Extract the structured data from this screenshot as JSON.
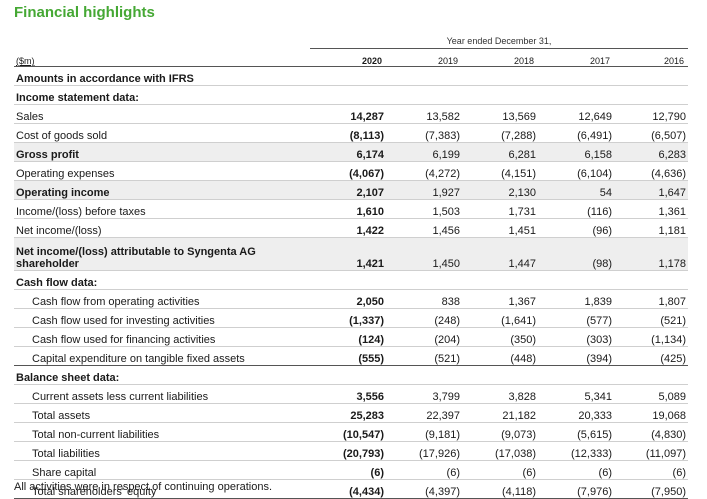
{
  "title": "Financial highlights",
  "period_label": "Year ended December 31,",
  "unit_label": "($m)",
  "years": [
    "2020",
    "2019",
    "2018",
    "2017",
    "2016"
  ],
  "rows": [
    {
      "label": "Amounts in accordance with IFRS",
      "type": "section",
      "values": []
    },
    {
      "label": "Income statement data:",
      "type": "section",
      "values": []
    },
    {
      "label": "Sales",
      "type": "row",
      "values": [
        "14,287",
        "13,582",
        "13,569",
        "12,649",
        "12,790"
      ]
    },
    {
      "label": "Cost of goods sold",
      "type": "row",
      "values": [
        "(8,113)",
        "(7,383)",
        "(7,288)",
        "(6,491)",
        "(6,507)"
      ]
    },
    {
      "label": "Gross profit",
      "type": "row",
      "bold": true,
      "shaded": true,
      "values": [
        "6,174",
        "6,199",
        "6,281",
        "6,158",
        "6,283"
      ]
    },
    {
      "label": "Operating expenses",
      "type": "row",
      "values": [
        "(4,067)",
        "(4,272)",
        "(4,151)",
        "(6,104)",
        "(4,636)"
      ]
    },
    {
      "label": "Operating income",
      "type": "row",
      "bold": true,
      "shaded": true,
      "values": [
        "2,107",
        "1,927",
        "2,130",
        "54",
        "1,647"
      ]
    },
    {
      "label": "Income/(loss) before taxes",
      "type": "row",
      "values": [
        "1,610",
        "1,503",
        "1,731",
        "(116)",
        "1,361"
      ]
    },
    {
      "label": "Net income/(loss)",
      "type": "row",
      "values": [
        "1,422",
        "1,456",
        "1,451",
        "(96)",
        "1,181"
      ]
    },
    {
      "label": "Net income/(loss) attributable to Syngenta AG shareholder",
      "type": "row",
      "bold": true,
      "shaded": true,
      "tall": true,
      "values": [
        "1,421",
        "1,450",
        "1,447",
        "(98)",
        "1,178"
      ]
    },
    {
      "label": "Cash flow data:",
      "type": "section",
      "values": []
    },
    {
      "label": "Cash flow from operating activities",
      "type": "row",
      "indent": true,
      "values": [
        "2,050",
        "838",
        "1,367",
        "1,839",
        "1,807"
      ]
    },
    {
      "label": "Cash flow used for investing activities",
      "type": "row",
      "indent": true,
      "values": [
        "(1,337)",
        "(248)",
        "(1,641)",
        "(577)",
        "(521)"
      ]
    },
    {
      "label": "Cash flow used for financing activities",
      "type": "row",
      "indent": true,
      "values": [
        "(124)",
        "(204)",
        "(350)",
        "(303)",
        "(1,134)"
      ]
    },
    {
      "label": "Capital expenditure on tangible fixed assets",
      "type": "row",
      "indent": true,
      "groupend": true,
      "values": [
        "(555)",
        "(521)",
        "(448)",
        "(394)",
        "(425)"
      ]
    },
    {
      "label": "Balance sheet data:",
      "type": "section",
      "values": []
    },
    {
      "label": "Current assets less current liabilities",
      "type": "row",
      "indent": true,
      "values": [
        "3,556",
        "3,799",
        "3,828",
        "5,341",
        "5,089"
      ]
    },
    {
      "label": "Total assets",
      "type": "row",
      "indent": true,
      "values": [
        "25,283",
        "22,397",
        "21,182",
        "20,333",
        "19,068"
      ]
    },
    {
      "label": "Total non-current liabilities",
      "type": "row",
      "indent": true,
      "values": [
        "(10,547)",
        "(9,181)",
        "(9,073)",
        "(5,615)",
        "(4,830)"
      ]
    },
    {
      "label": "Total liabilities",
      "type": "row",
      "indent": true,
      "values": [
        "(20,793)",
        "(17,926)",
        "(17,038)",
        "(12,333)",
        "(11,097)"
      ]
    },
    {
      "label": "Share capital",
      "type": "row",
      "indent": true,
      "values": [
        "(6)",
        "(6)",
        "(6)",
        "(6)",
        "(6)"
      ]
    },
    {
      "label": "Total shareholders' equity",
      "type": "row",
      "indent": true,
      "groupend": true,
      "values": [
        "(4,434)",
        "(4,397)",
        "(4,118)",
        "(7,976)",
        "(7,950)"
      ]
    }
  ],
  "footnote": "All activities were in respect of continuing operations."
}
